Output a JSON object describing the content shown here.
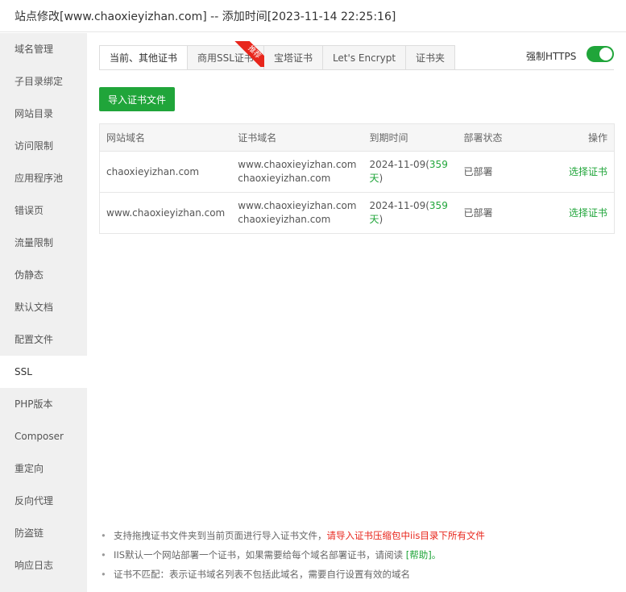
{
  "window": {
    "title": "站点修改[www.chaoxieyizhan.com] -- 添加时间[2023-11-14 22:25:16]"
  },
  "sidebar": {
    "items": [
      {
        "label": "域名管理"
      },
      {
        "label": "子目录绑定"
      },
      {
        "label": "网站目录"
      },
      {
        "label": "访问限制"
      },
      {
        "label": "应用程序池"
      },
      {
        "label": "错误页"
      },
      {
        "label": "流量限制"
      },
      {
        "label": "伪静态"
      },
      {
        "label": "默认文档"
      },
      {
        "label": "配置文件"
      },
      {
        "label": "SSL"
      },
      {
        "label": "PHP版本"
      },
      {
        "label": "Composer"
      },
      {
        "label": "重定向"
      },
      {
        "label": "反向代理"
      },
      {
        "label": "防盗链"
      },
      {
        "label": "响应日志"
      }
    ],
    "active_index": 10
  },
  "tabs": [
    {
      "label": "当前、其他证书"
    },
    {
      "label": "商用SSL证书",
      "badge": "推荐"
    },
    {
      "label": "宝塔证书"
    },
    {
      "label": "Let's Encrypt"
    },
    {
      "label": "证书夹"
    }
  ],
  "force_https": {
    "label": "强制HTTPS",
    "enabled": true
  },
  "import_button": {
    "label": "导入证书文件"
  },
  "table": {
    "headers": [
      "网站域名",
      "证书域名",
      "到期时间",
      "部署状态",
      "操作"
    ],
    "rows": [
      {
        "site": "chaoxieyizhan.com",
        "cert1": "www.chaoxieyizhan.com",
        "cert2": "chaoxieyizhan.com",
        "expiry_date": "2024-11-09(",
        "days": "359",
        "day_unit": "天",
        "close": ")",
        "status": "已部署",
        "action": "选择证书"
      },
      {
        "site": "www.chaoxieyizhan.com",
        "cert1": "www.chaoxieyizhan.com",
        "cert2": "chaoxieyizhan.com",
        "expiry_date": "2024-11-09(",
        "days": "359",
        "day_unit": "天",
        "close": ")",
        "status": "已部署",
        "action": "选择证书"
      }
    ]
  },
  "notes": {
    "n1_text": "支持拖拽证书文件夹到当前页面进行导入证书文件，",
    "n1_red": "请导入证书压缩包中iis目录下所有文件",
    "n2_text": "IIS默认一个网站部署一个证书，如果需要给每个域名部署证书，请阅读 ",
    "n2_help": "[帮助]",
    "n2_end": "。",
    "n3_text": "证书不匹配：表示证书域名列表不包括此域名，需要自行设置有效的域名"
  },
  "colors": {
    "accent": "#20a53a",
    "warning": "#e8261c",
    "sidebar_bg": "#f0f0f0"
  }
}
